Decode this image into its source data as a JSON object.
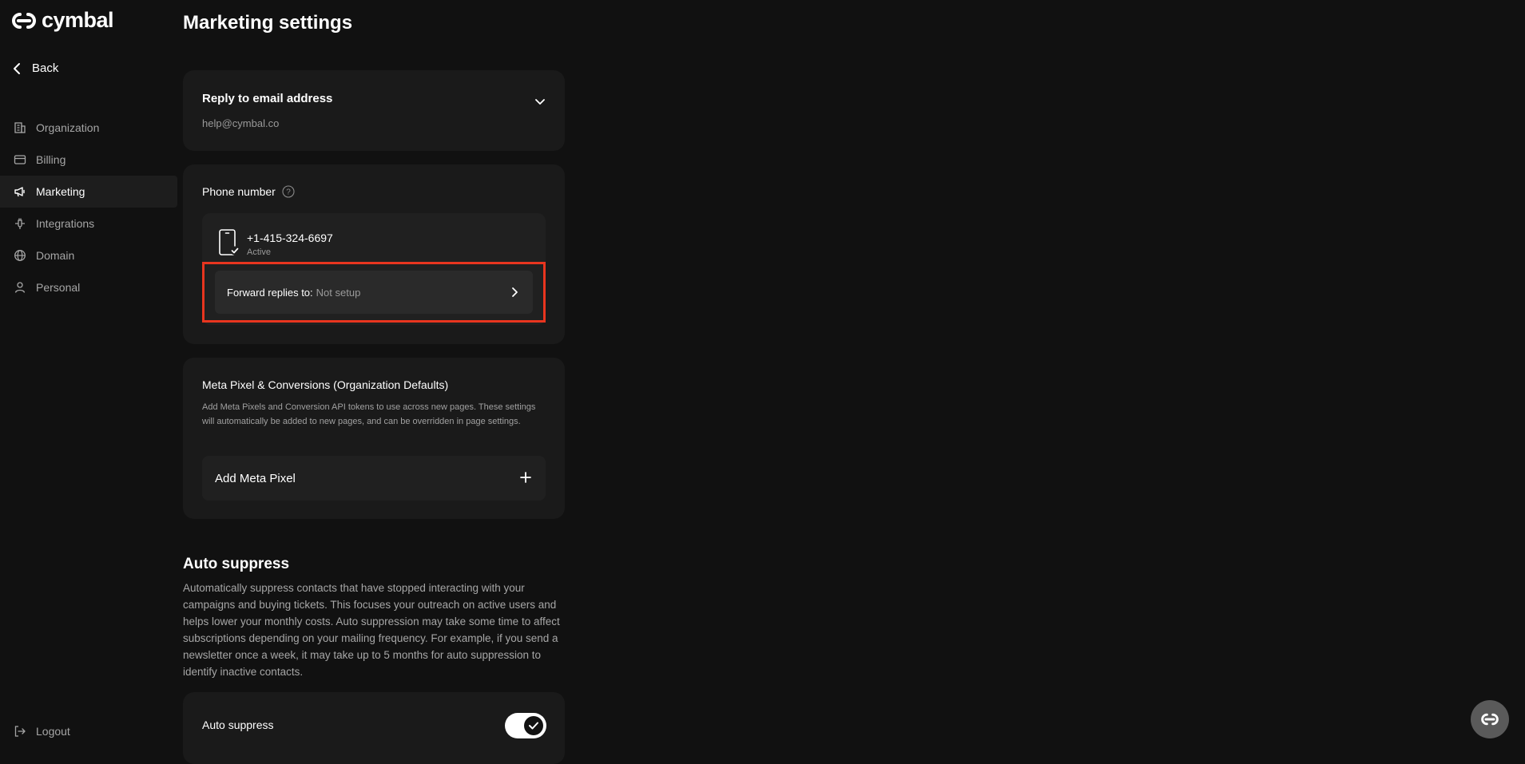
{
  "brand": {
    "name": "cymbal"
  },
  "sidebar": {
    "back_label": "Back",
    "items": [
      {
        "label": "Organization",
        "icon": "building-icon"
      },
      {
        "label": "Billing",
        "icon": "credit-card-icon"
      },
      {
        "label": "Marketing",
        "icon": "megaphone-icon",
        "active": true
      },
      {
        "label": "Integrations",
        "icon": "plug-icon"
      },
      {
        "label": "Domain",
        "icon": "globe-icon"
      },
      {
        "label": "Personal",
        "icon": "user-icon"
      }
    ],
    "logout_label": "Logout"
  },
  "page": {
    "title": "Marketing settings"
  },
  "reply_email": {
    "title": "Reply to email address",
    "value": "help@cymbal.co"
  },
  "phone": {
    "label": "Phone number",
    "number": "+1-415-324-6697",
    "status": "Active",
    "forward_label": "Forward replies to:",
    "forward_value": "Not setup"
  },
  "meta_pixel": {
    "title": "Meta Pixel & Conversions (Organization Defaults)",
    "description": "Add Meta Pixels and Conversion API tokens to use across new pages. These settings will automatically be added to new pages, and can be overridden in page settings.",
    "add_label": "Add Meta Pixel"
  },
  "auto_suppress": {
    "section_title": "Auto suppress",
    "description": "Automatically suppress contacts that have stopped interacting with your campaigns and buying tickets. This focuses your outreach on active users and helps lower your monthly costs. Auto suppression may take some time to affect subscriptions depending on your mailing frequency. For example, if you send a newsletter once a week, it may take up to 5 months for auto suppression to identify inactive contacts.",
    "toggle_label": "Auto suppress",
    "enabled": true
  },
  "colors": {
    "background": "#111111",
    "card": "#1a1a1a",
    "highlight": "#e8351f"
  }
}
